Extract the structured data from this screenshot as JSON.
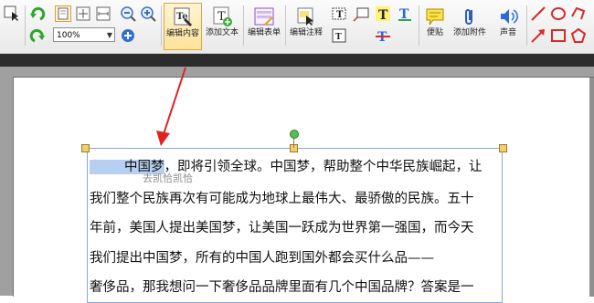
{
  "toolbar": {
    "zoom_value": "100%",
    "buttons": [
      {
        "label": "编辑内容",
        "icon": "edit-content-icon",
        "active": true
      },
      {
        "label": "添加文本",
        "icon": "add-text-icon"
      },
      {
        "label": "编辑表单",
        "icon": "edit-form-icon"
      },
      {
        "label": "编辑注释",
        "icon": "edit-annotation-icon"
      },
      {
        "label": "便贴",
        "icon": "sticky-note-icon"
      },
      {
        "label": "添加附件",
        "icon": "attachment-icon"
      },
      {
        "label": "声音",
        "icon": "sound-icon"
      }
    ],
    "colors": {
      "accent": "#e8b94a",
      "text_tool": "#2a6ad8",
      "shape_tool": "#d82a2a"
    }
  },
  "document": {
    "highlighted": "中国梦",
    "lines": [
      "，即将引领全球。中国梦，帮助整个中华民族崛起，让",
      "我们整个民族再次有可能成为地球上最伟大、最骄傲的民族。五十",
      "年前，美国人提出美国梦，让美国一跃成为世界第一强国，而今天",
      "我们提出中国梦，所有的中国人跑到国外都会买什么品——",
      "奢侈品，那我想问一下奢侈品品牌里面有几个中国品牌？答案是一"
    ],
    "ghost_text": "去凯恰凯恰"
  }
}
